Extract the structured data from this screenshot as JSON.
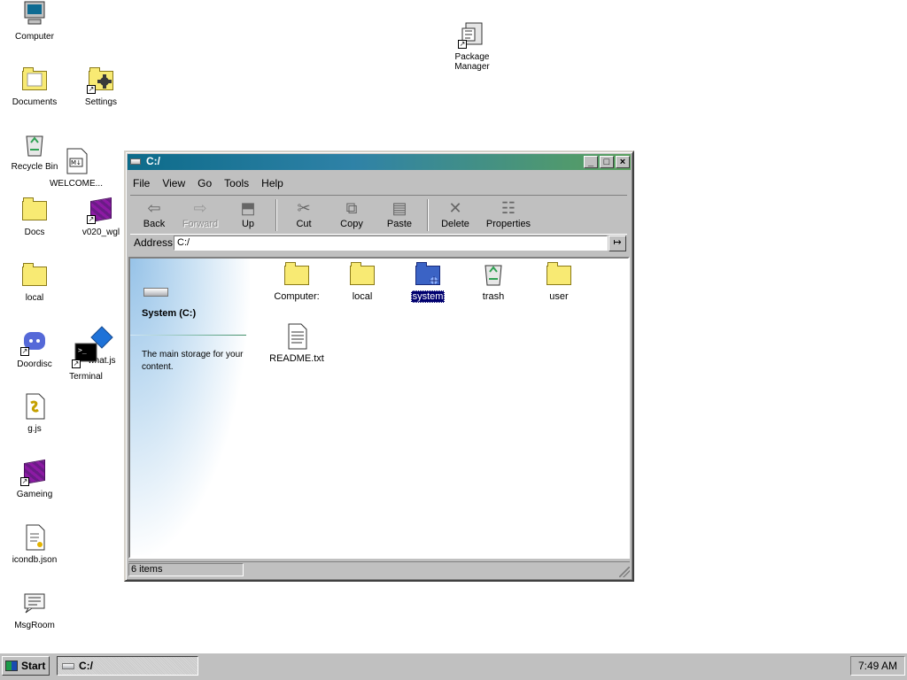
{
  "desktop": {
    "icons": [
      {
        "label": "Computer",
        "icon": "computer-icon"
      },
      {
        "label": "Package Manager",
        "icon": "package-manager-icon"
      },
      {
        "label": "Documents",
        "icon": "documents-folder-icon"
      },
      {
        "label": "Settings",
        "icon": "settings-icon"
      },
      {
        "label": "Recycle Bin",
        "icon": "recycle-bin-icon"
      },
      {
        "label": "WELCOME...",
        "icon": "markdown-file-icon"
      },
      {
        "label": "Docs",
        "icon": "folder-icon"
      },
      {
        "label": "v020_wgl",
        "icon": "purple-cube-icon"
      },
      {
        "label": "local",
        "icon": "folder-icon"
      },
      {
        "label": "Doordisc",
        "icon": "doordisc-icon"
      },
      {
        "label": "what.js",
        "icon": "script-file-icon"
      },
      {
        "label": "Terminal",
        "icon": "terminal-icon"
      },
      {
        "label": "g.js",
        "icon": "javascript-file-icon"
      },
      {
        "label": "Gameing",
        "icon": "purple-cube-icon"
      },
      {
        "label": "icondb.json",
        "icon": "json-file-icon"
      },
      {
        "label": "MsgRoom",
        "icon": "msgroom-icon"
      }
    ]
  },
  "window": {
    "title": "C:/",
    "menu": [
      "File",
      "View",
      "Go",
      "Tools",
      "Help"
    ],
    "toolbar": {
      "back": "Back",
      "forward": "Forward",
      "up": "Up",
      "cut": "Cut",
      "copy": "Copy",
      "paste": "Paste",
      "delete": "Delete",
      "properties": "Properties"
    },
    "address_label": "Address",
    "address_value": "C:/",
    "sidebar": {
      "title": "System (C:)",
      "description": "The main storage for your content."
    },
    "items": [
      {
        "label": "Computer:",
        "icon": "folder-icon"
      },
      {
        "label": "local",
        "icon": "folder-icon"
      },
      {
        "label": "system",
        "icon": "system-folder-icon",
        "selected": true
      },
      {
        "label": "trash",
        "icon": "recycle-bin-icon"
      },
      {
        "label": "user",
        "icon": "folder-icon"
      },
      {
        "label": "README.txt",
        "icon": "text-file-icon"
      }
    ],
    "status": "6 items"
  },
  "taskbar": {
    "start": "Start",
    "active_task": "C:/",
    "clock": "7:49 AM"
  },
  "colors": {
    "title_start": "#0d6b8a",
    "title_end": "#5aa05d",
    "selection": "#00006f",
    "folder_yellow": "#f8ea73"
  }
}
